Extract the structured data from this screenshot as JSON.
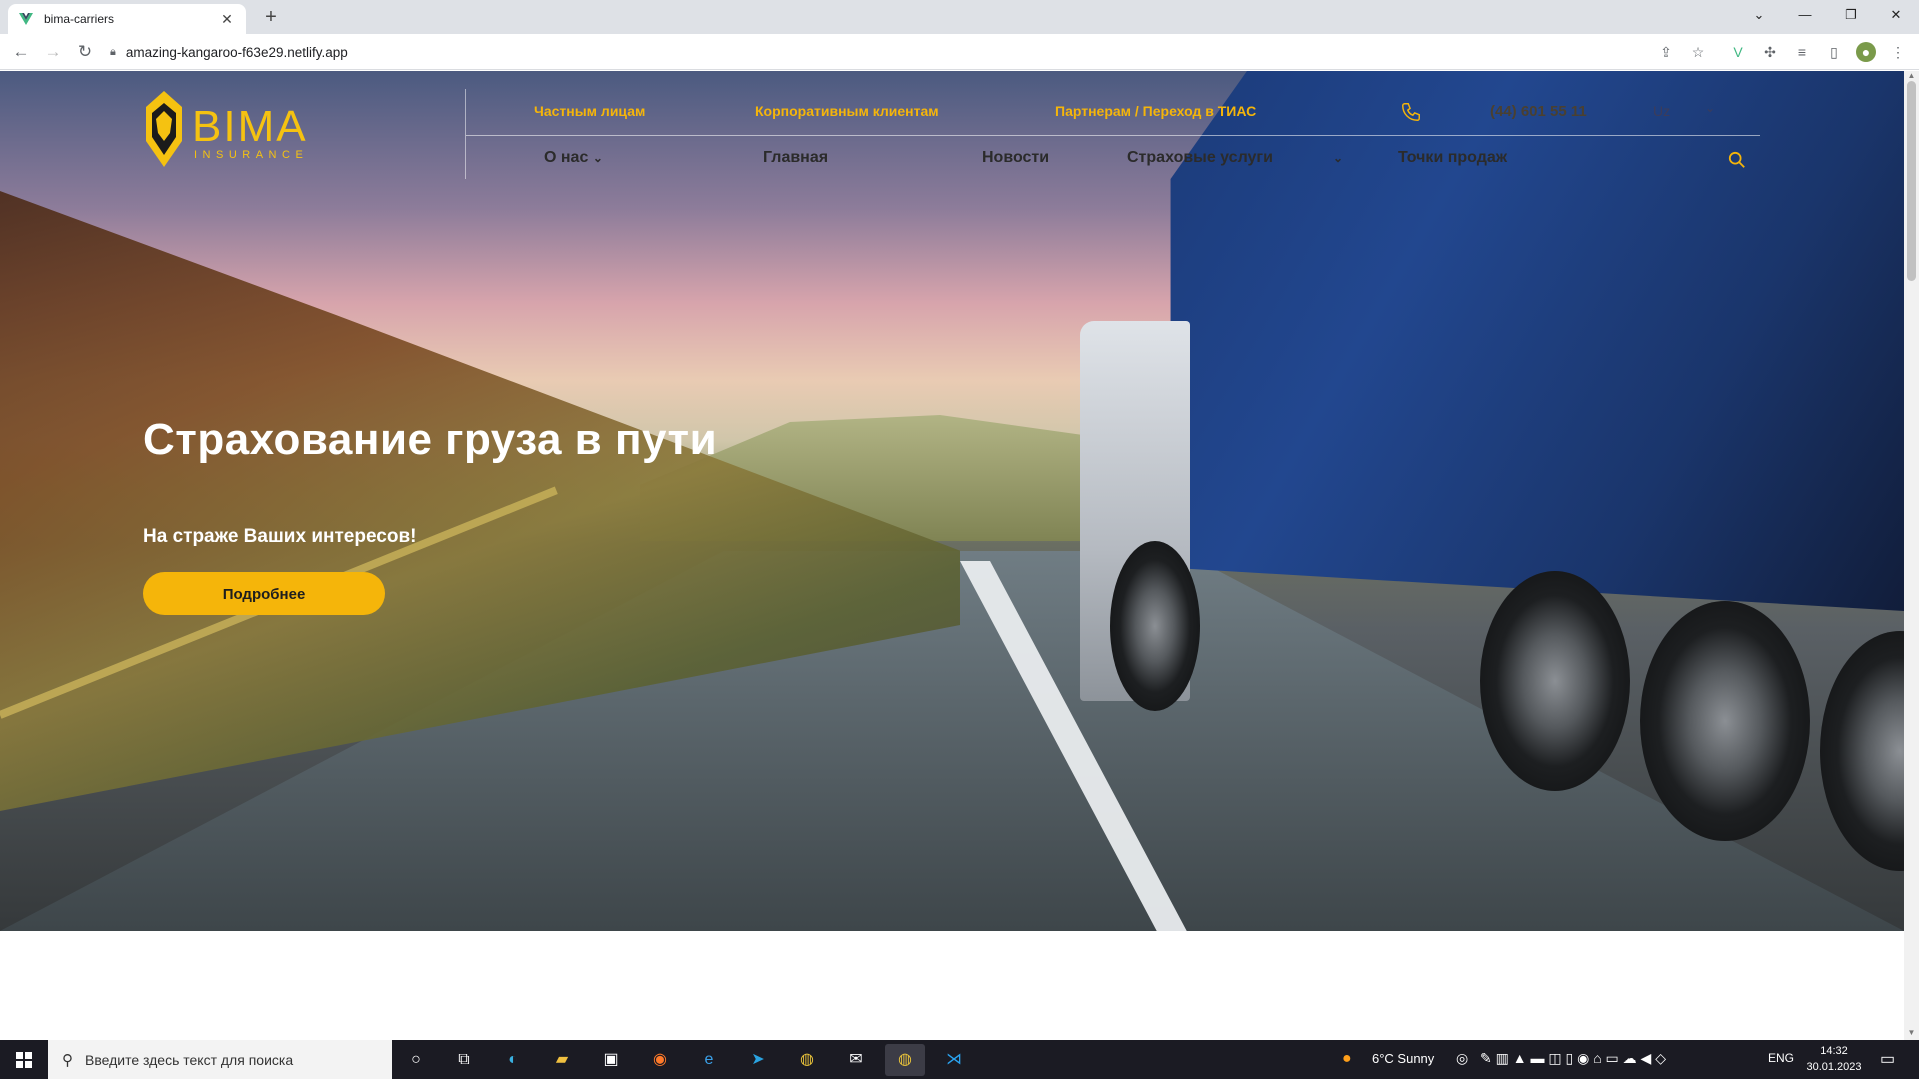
{
  "browser": {
    "tab_title": "bima-carriers",
    "url": "amazing-kangaroo-f63e29.netlify.app"
  },
  "site": {
    "logo_text": "BIMA",
    "logo_subtext": "INSURANCE",
    "top_links": [
      "Частным лицам",
      "Корпоративным клиентам",
      "Партнерам / Переход в ТИАС"
    ],
    "phone": "(44) 601 55 11",
    "language": "Uz",
    "nav": [
      "О нас",
      "Главная",
      "Новости",
      "Страховые услуги",
      "Точки продаж"
    ],
    "hero_title": "Страхование груза в пути",
    "hero_subtitle": "На страже Ваших интересов!",
    "cta_label": "Подробнее",
    "colors": {
      "accent": "#f5b50a"
    }
  },
  "taskbar": {
    "search_placeholder": "Введите здесь текст для поиска",
    "weather": "6°C  Sunny",
    "lang": "ENG",
    "time": "14:32",
    "date": "30.01.2023"
  }
}
